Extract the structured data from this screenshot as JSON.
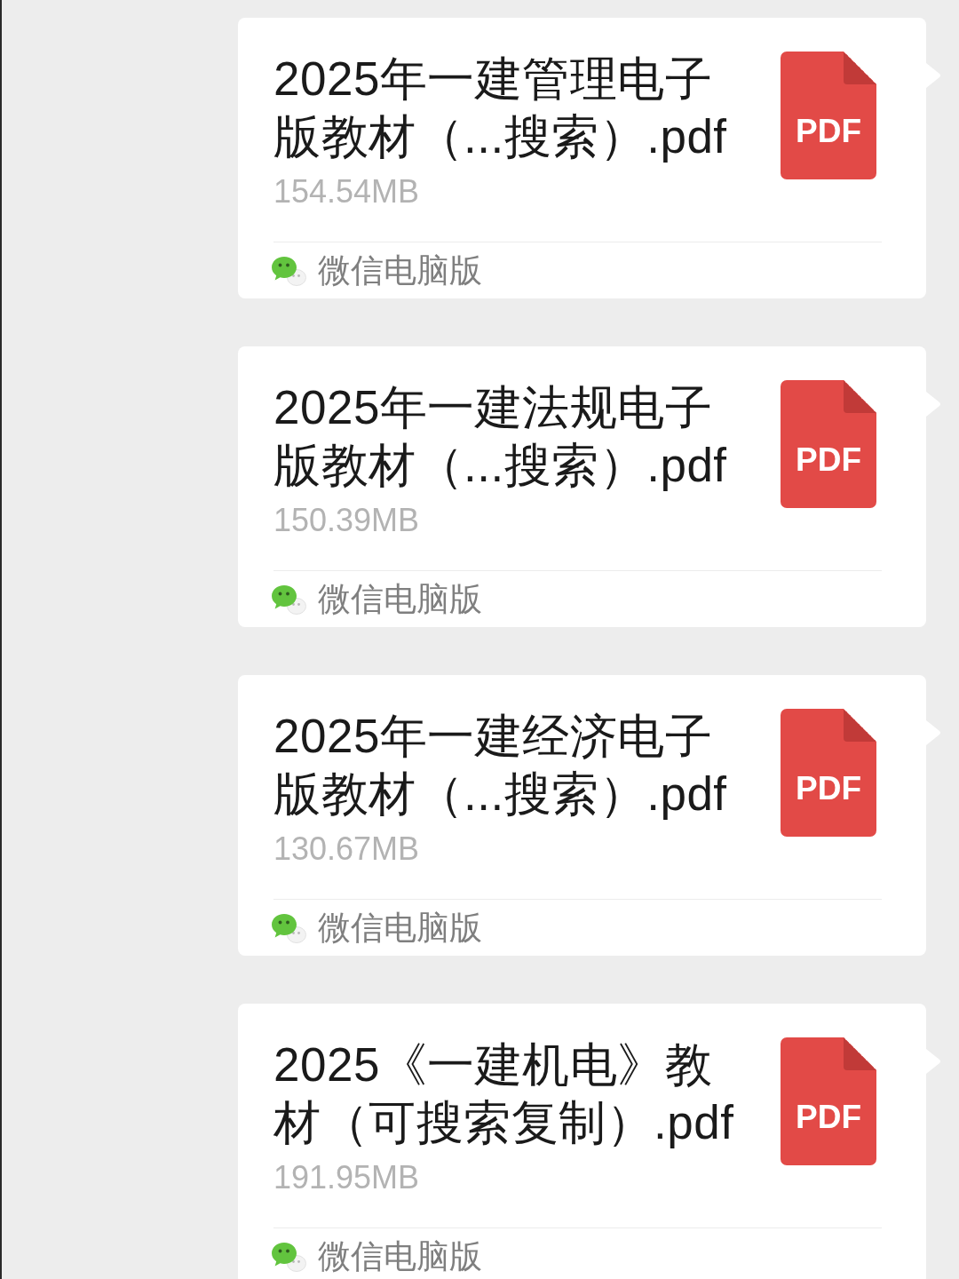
{
  "messages": [
    {
      "file_name": "2025年一建管理电子版教材（...搜索）.pdf",
      "file_size": "154.54MB",
      "file_type": "PDF",
      "source": "微信电脑版"
    },
    {
      "file_name": "2025年一建法规电子版教材（...搜索）.pdf",
      "file_size": "150.39MB",
      "file_type": "PDF",
      "source": "微信电脑版"
    },
    {
      "file_name": "2025年一建经济电子版教材（...搜索）.pdf",
      "file_size": "130.67MB",
      "file_type": "PDF",
      "source": "微信电脑版"
    },
    {
      "file_name": "2025《一建机电》教材（可搜索复制）.pdf",
      "file_size": "191.95MB",
      "file_type": "PDF",
      "source": "微信电脑版"
    }
  ]
}
